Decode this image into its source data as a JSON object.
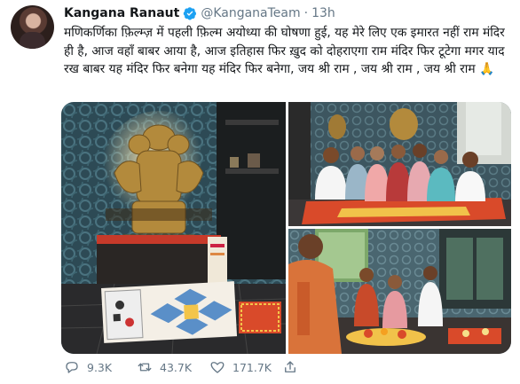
{
  "tweet": {
    "author_name": "Kangana Ranaut",
    "handle": "@KanganaTeam",
    "separator": "·",
    "time": "13h",
    "text": "मणिकर्णिका फ़िल्म्ज़ में पहली फ़िल्म अयोध्या की घोषणा हुई, यह मेरे लिए एक इमारत नहीं राम मंदिर ही है, आज वहाँ बाबर आया है, आज इतिहास फिर ख़ुद को दोहराएगा राम मंदिर फिर टूटेगा मगर याद रख बाबर यह मंदिर फिर बनेगा यह मंदिर फिर बनेगा, जय श्री राम , जय श्री राम , जय श्री राम 🙏"
  },
  "actions": {
    "replies": "9.3K",
    "retweets": "43.7K",
    "likes": "171.7K"
  },
  "icons": {
    "verified": "verified-badge-icon",
    "reply": "reply-icon",
    "retweet": "retweet-icon",
    "like": "heart-icon",
    "share": "share-icon"
  },
  "colors": {
    "verified_blue": "#1da1f2",
    "text_primary": "#14171a",
    "text_secondary": "#657786"
  }
}
